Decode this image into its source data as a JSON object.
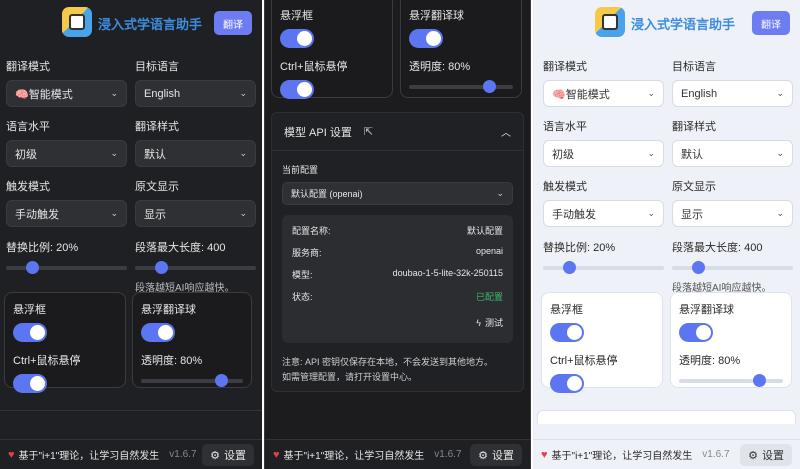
{
  "app": {
    "title": "浸入式学语言助手",
    "translate_label": "翻译"
  },
  "settings": {
    "translate_mode": {
      "label": "翻译模式",
      "value": "🧠智能模式"
    },
    "target_language": {
      "label": "目标语言",
      "value": "English"
    },
    "language_level": {
      "label": "语言水平",
      "value": "初级"
    },
    "translate_style": {
      "label": "翻译样式",
      "value": "默认"
    },
    "trigger_mode": {
      "label": "触发模式",
      "value": "手动触发"
    },
    "original_display": {
      "label": "原文显示",
      "value": "显示"
    },
    "replace_ratio": {
      "label": "替换比例: 20%",
      "value": 0.2
    },
    "max_paragraph": {
      "label": "段落最大长度: 400",
      "value": 0.2,
      "hint": "段落越短AI响应越快。"
    }
  },
  "floating": {
    "float_box_label": "悬浮框",
    "float_box_on": true,
    "ctrl_hover_label": "Ctrl+鼠标悬停",
    "ctrl_hover_on": true,
    "float_ball_label": "悬浮翻译球",
    "float_ball_on": true,
    "opacity_label": "透明度: 80%",
    "opacity_value": 0.8
  },
  "api": {
    "section_title": "模型 API 设置",
    "current_config_label": "当前配置",
    "current_config_value": "默认配置 (openai)",
    "rows": [
      {
        "key": "配置名称:",
        "value": "默认配置"
      },
      {
        "key": "服务商:",
        "value": "openai"
      },
      {
        "key": "模型:",
        "value": "doubao-1-5-lite-32k-250115"
      },
      {
        "key": "状态:",
        "value": "已配置"
      }
    ],
    "test_label": "测试",
    "note_line1": "注意: API 密钥仅保存在本地，不会发送到其他地方。",
    "note_line2": "如需管理配置，请打开设置中心。"
  },
  "footer": {
    "tagline": "基于\"i+1\"理论，让学习自然发生",
    "version": "v1.6.7",
    "settings_label": "设置"
  },
  "colors": {
    "accent": "#5b76f0",
    "title": "#3c8de0",
    "ok": "#3fba6c"
  }
}
